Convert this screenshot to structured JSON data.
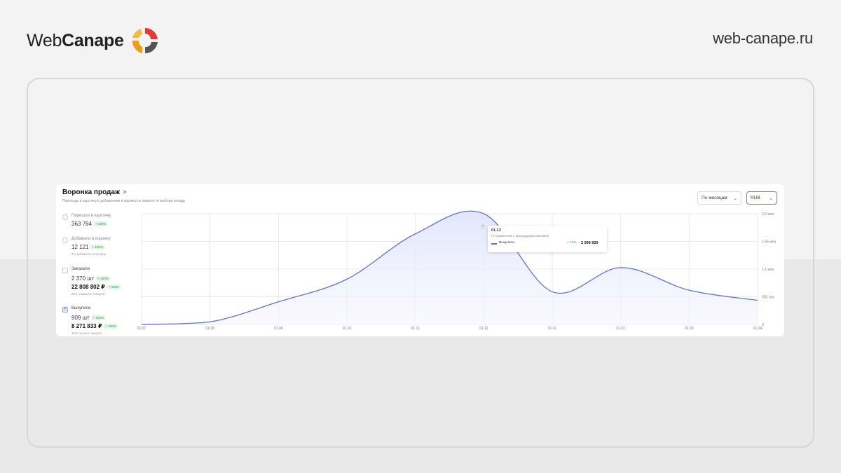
{
  "brand": {
    "name_light": "Web",
    "name_bold": "Canape",
    "site": "web-canape.ru",
    "colors": {
      "orange": "#f39c12",
      "red": "#e53935",
      "gray": "#666666"
    }
  },
  "card": {
    "title": "Воронка продаж",
    "title_arrow": ">",
    "subtitle": "Переходы в карточку и добавления в корзину не зависят от выбора склада",
    "period_select": "По месяцам",
    "currency_select": "RUB"
  },
  "metrics": [
    {
      "label": "Перешли в карточку",
      "value": "363 764",
      "badge": "+ 100%",
      "checked": false
    },
    {
      "label": "Добавили в корзину",
      "value": "12 121",
      "badge": "+ 100%",
      "note": "3% добавили в корзину",
      "checked": false
    },
    {
      "label": "Заказали",
      "value": "2 370 шт",
      "badge": "+ 100%",
      "value2": "22 808 802 ₽",
      "badge2": "+ 100%",
      "note": "20% заказали товаров",
      "checked": false
    },
    {
      "label": "Выкупили",
      "value": "909 шт",
      "badge": "+ 100%",
      "value2": "8 271 833 ₽",
      "badge2": "+ 100%",
      "note": "40% процент выкупа",
      "checked": true
    }
  ],
  "tooltip": {
    "date": "01.12",
    "subtitle": "По сравнению с предыдущим месяцем",
    "series_name": "Выкупили",
    "delta": "+ 14%",
    "value": "2 090 920"
  },
  "chart_data": {
    "type": "area",
    "x": [
      "01.07",
      "01.08",
      "01.09",
      "01.10",
      "01.11",
      "01.12",
      "01.01",
      "01.02",
      "01.03",
      "01.04"
    ],
    "series": [
      {
        "name": "Выкупили",
        "values": [
          0,
          50000,
          450000,
          900000,
          1800000,
          2200000,
          650000,
          1130000,
          680000,
          480000
        ]
      }
    ],
    "y_tick_labels": [
      "0",
      "550 тыс",
      "1,1 млн",
      "1,65 млн",
      "2,2 млн"
    ],
    "y_ticks": [
      0,
      550000,
      1100000,
      1650000,
      2200000
    ],
    "ylim": [
      0,
      2200000
    ],
    "grid": true,
    "line_color": "#5d73d8",
    "fill_color": "#e9ecfb"
  }
}
